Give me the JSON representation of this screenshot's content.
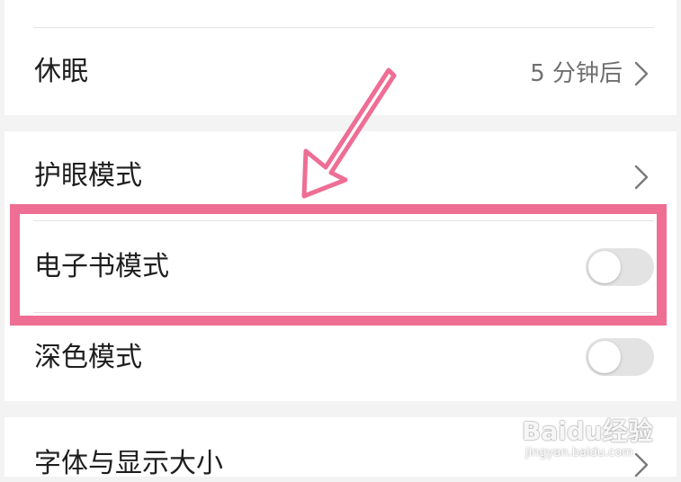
{
  "settings": {
    "sleep": {
      "label": "休眠",
      "value": "5 分钟后"
    },
    "eye_comfort": {
      "label": "护眼模式"
    },
    "ebook_mode": {
      "label": "电子书模式",
      "enabled": false
    },
    "dark_mode": {
      "label": "深色模式",
      "enabled": false
    },
    "font_display": {
      "label": "字体与显示大小"
    }
  },
  "watermark": {
    "logo": "Baidu经验",
    "url": "jingyan.baidu.com"
  },
  "colors": {
    "annotation": "#ee6e94",
    "toggle_off": "#e3e3e3",
    "section_gap": "#f3f3f3"
  },
  "icons": {
    "chevron": "chevron-right-icon",
    "arrow": "annotation-arrow-icon"
  }
}
